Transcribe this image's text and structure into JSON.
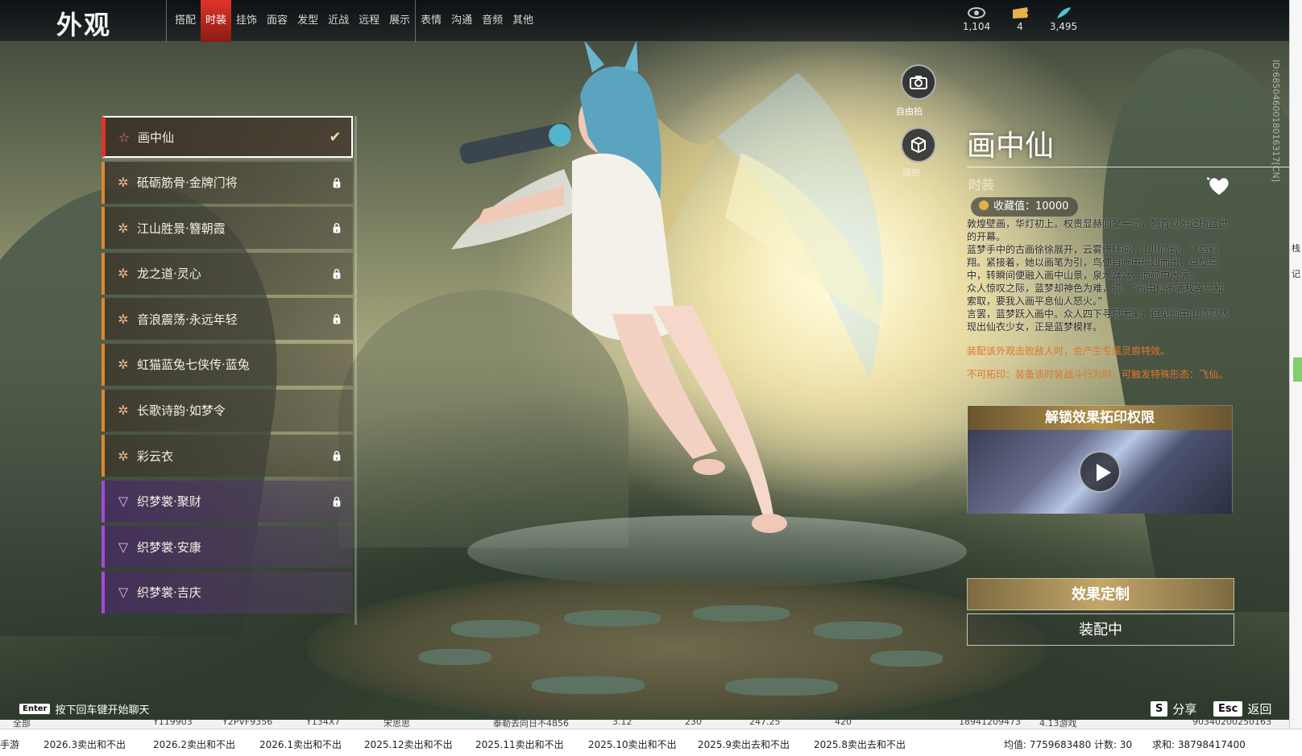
{
  "header": {
    "title": "外观",
    "tabs": [
      {
        "label": "搭配",
        "active": false,
        "sep": false
      },
      {
        "label": "时装",
        "active": true,
        "sep": false
      },
      {
        "label": "挂饰",
        "active": false,
        "sep": false
      },
      {
        "label": "面容",
        "active": false,
        "sep": false
      },
      {
        "label": "发型",
        "active": false,
        "sep": false
      },
      {
        "label": "近战",
        "active": false,
        "sep": false
      },
      {
        "label": "远程",
        "active": false,
        "sep": false
      },
      {
        "label": "展示",
        "active": false,
        "sep": false
      },
      {
        "label": "表情",
        "active": false,
        "sep": true
      },
      {
        "label": "沟通",
        "active": false,
        "sep": false
      },
      {
        "label": "音频",
        "active": false,
        "sep": false
      },
      {
        "label": "其他",
        "active": false,
        "sep": false
      }
    ],
    "currencies": [
      {
        "icon": "eye-token-icon",
        "value": "1,104",
        "color": "#c9c9c9"
      },
      {
        "icon": "ticket-icon",
        "value": "4",
        "color": "#e8b24a"
      },
      {
        "icon": "feather-icon",
        "value": "3,495",
        "color": "#4fc3d8"
      }
    ]
  },
  "costume_list": [
    {
      "name": "画中仙",
      "tier": "red",
      "selected": true,
      "status": "equipped"
    },
    {
      "name": "砥砺筋骨·金牌门将",
      "tier": "orange",
      "selected": false,
      "status": "locked"
    },
    {
      "name": "江山胜景·簪朝霞",
      "tier": "orange",
      "selected": false,
      "status": "locked"
    },
    {
      "name": "龙之道·灵心",
      "tier": "orange",
      "selected": false,
      "status": "locked"
    },
    {
      "name": "音浪震荡·永远年轻",
      "tier": "orange",
      "selected": false,
      "status": "locked"
    },
    {
      "name": "虹猫蓝兔七侠传·蓝兔",
      "tier": "orange",
      "selected": false,
      "status": "none"
    },
    {
      "name": "长歌诗韵·如梦令",
      "tier": "orange",
      "selected": false,
      "status": "none"
    },
    {
      "name": "彩云衣",
      "tier": "orange",
      "selected": false,
      "status": "locked"
    },
    {
      "name": "织梦裳·聚财",
      "tier": "purple",
      "selected": false,
      "status": "locked"
    },
    {
      "name": "织梦裳·安康",
      "tier": "purple",
      "selected": false,
      "status": "none"
    },
    {
      "name": "织梦裳·吉庆",
      "tier": "purple",
      "selected": false,
      "status": "none"
    }
  ],
  "side_buttons": {
    "camera_label": "自由拍",
    "model_label": "摆拍"
  },
  "detail": {
    "title": "画中仙",
    "subtitle": "时装",
    "collect_value": "收藏值：10000",
    "description": [
      "敦煌壁画，华灯初上。权贵显赫同聚一堂，翘首以盼这场盛世的开幕。",
      "蓝梦手中的古画徐徐展开，云雾缭绕间，山川隐现，飞鸟翱翔。紧接着，她以画笔为引，鸟便自画中振翅而出，盘旋空中，转瞬间便融入画中山景，泉水潺潺，而碗中水满。",
      "众人惊叹之际，蓝梦却神色为难，道：“画中仙不满我等只知索取，要我入画平息仙人怒火。”",
      "言罢，蓝梦跃入画中。众人四下寻觅无果，但见画中山顶忽然现出仙衣少女，正是蓝梦模样。"
    ],
    "note1": "装配该外观击败敌人时，会产生专属灵痕特效。",
    "note2": "不可拓印：装备该时装战斗行为时，可触发特殊形态：飞仙。",
    "unlock_title": "解锁效果拓印权限",
    "effect_button": "效果定制",
    "equip_button": "装配中"
  },
  "bottom": {
    "chat_key": "Enter",
    "chat_hint": "按下回车键开始聊天",
    "share_key": "S",
    "share_label": "分享",
    "back_key": "Esc",
    "back_label": "返回",
    "vertical_id": "ID:6850460018016317[CN]"
  },
  "host": {
    "right_chars": [
      "栈",
      "记"
    ],
    "ghost_row": [
      "全部",
      "Y119903",
      "Y2PVF9356",
      "Y134X7",
      "宋思思",
      "泰勒去向日不4856",
      "3.12",
      "230",
      "247.25",
      "420",
      "18941209473",
      "4.13游戏",
      "90340200250163"
    ],
    "sheet_tabs": [
      "手游",
      "2026.3卖出和不出",
      "2026.2卖出和不出",
      "2026.1卖出和不出",
      "2025.12卖出和不出",
      "2025.11卖出和不出",
      "2025.10卖出和不出",
      "2025.9卖出去和不出",
      "2025.8卖出去和不出"
    ],
    "stats": {
      "avg": "均值: 7759683480",
      "count": "计数: 30",
      "sum": "求和: 38798417400"
    }
  }
}
